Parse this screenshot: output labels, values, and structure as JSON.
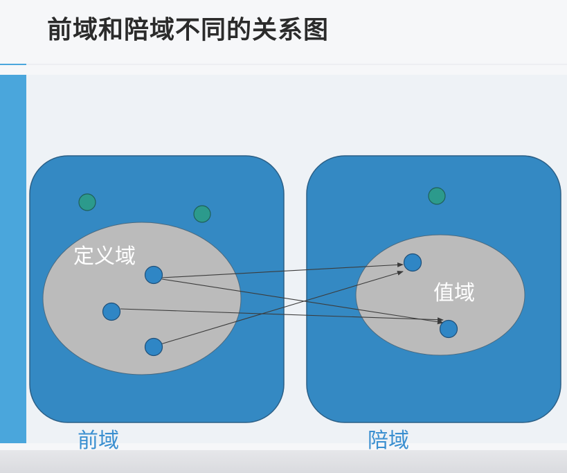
{
  "slide": {
    "title": "前域和陪域不同的关系图"
  },
  "diagram": {
    "domain_label": "定义域",
    "codomain_inner_label": "值域",
    "left_caption": "前域",
    "right_caption": "陪域"
  },
  "colors": {
    "box_fill": "#3489c3",
    "box_stroke": "#2b5f86",
    "ellipse_fill": "#bbbbbb",
    "node_fill": "#2f86c5",
    "teal_node_fill": "#2c9a8c",
    "caption_text": "#3a8fd0",
    "sidebar": "#4aa6dc",
    "arrow": "#3b3b3b"
  }
}
